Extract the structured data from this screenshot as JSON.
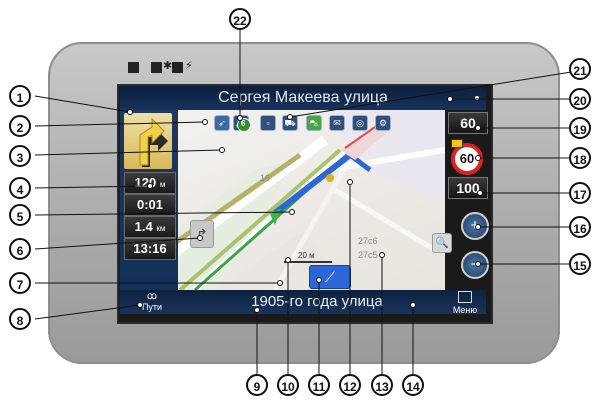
{
  "device": {
    "indicator_text": "■ ■✱■⚡"
  },
  "map": {
    "top_street": "Сергея Макеева улица",
    "bottom_street": "1905-го года улица",
    "speed_limit_box": "60",
    "speed_sign": "60",
    "speed_value": "100",
    "scale_label": "20 м",
    "house_number_1": "27с6",
    "house_number_2": "27с5",
    "house_number_16": "16",
    "left_panel": {
      "speed": "120",
      "speed_unit": "м",
      "time_to": "0:01",
      "distance": "1.4",
      "distance_unit": "км",
      "arrival": "13:16"
    },
    "menu_label": "Меню",
    "route_label": "Пути"
  },
  "callouts": [
    "1",
    "2",
    "3",
    "4",
    "5",
    "6",
    "7",
    "8",
    "9",
    "10",
    "11",
    "12",
    "13",
    "14",
    "15",
    "16",
    "17",
    "18",
    "19",
    "20",
    "21",
    "22"
  ],
  "icon_bar": {
    "badge_count": "6",
    "traffic_count": "6"
  }
}
